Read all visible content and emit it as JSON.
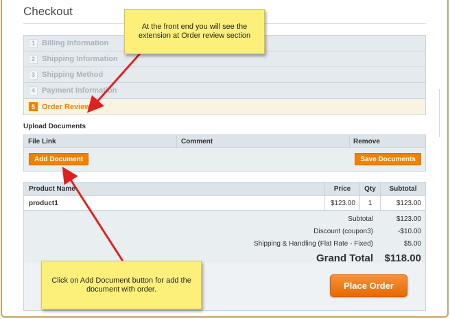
{
  "page": {
    "title": "Checkout"
  },
  "steps": [
    {
      "num": "1",
      "label": "Billing Information",
      "active": false
    },
    {
      "num": "2",
      "label": "Shipping Information",
      "active": false
    },
    {
      "num": "3",
      "label": "Shipping Method",
      "active": false
    },
    {
      "num": "4",
      "label": "Payment Information",
      "active": false
    },
    {
      "num": "5",
      "label": "Order Review",
      "active": true
    }
  ],
  "upload": {
    "section_label": "Upload Documents",
    "columns": [
      "File Link",
      "Comment",
      "Remove"
    ],
    "add_button": "Add Document",
    "save_button": "Save Documents"
  },
  "order": {
    "columns": [
      "Product Name",
      "Price",
      "Qty",
      "Subtotal"
    ],
    "items": [
      {
        "name": "product1",
        "price": "$123.00",
        "qty": "1",
        "subtotal": "$123.00"
      }
    ],
    "totals": [
      {
        "label": "Subtotal",
        "value": "$123.00"
      },
      {
        "label": "Discount (coupon3)",
        "value": "-$10.00"
      },
      {
        "label": "Shipping & Handling (Flat Rate - Fixed)",
        "value": "$5.00"
      }
    ],
    "grand_total": {
      "label": "Grand Total",
      "value": "$118.00"
    },
    "place_order": "Place Order"
  },
  "annotations": {
    "top_note": "At the front end you will see the extension at Order review section",
    "bottom_note": "Click on Add Document button for add the document with order."
  },
  "colors": {
    "accent": "#f18200",
    "note_yellow": "#fdf07a",
    "arrow_red": "#e02020"
  }
}
